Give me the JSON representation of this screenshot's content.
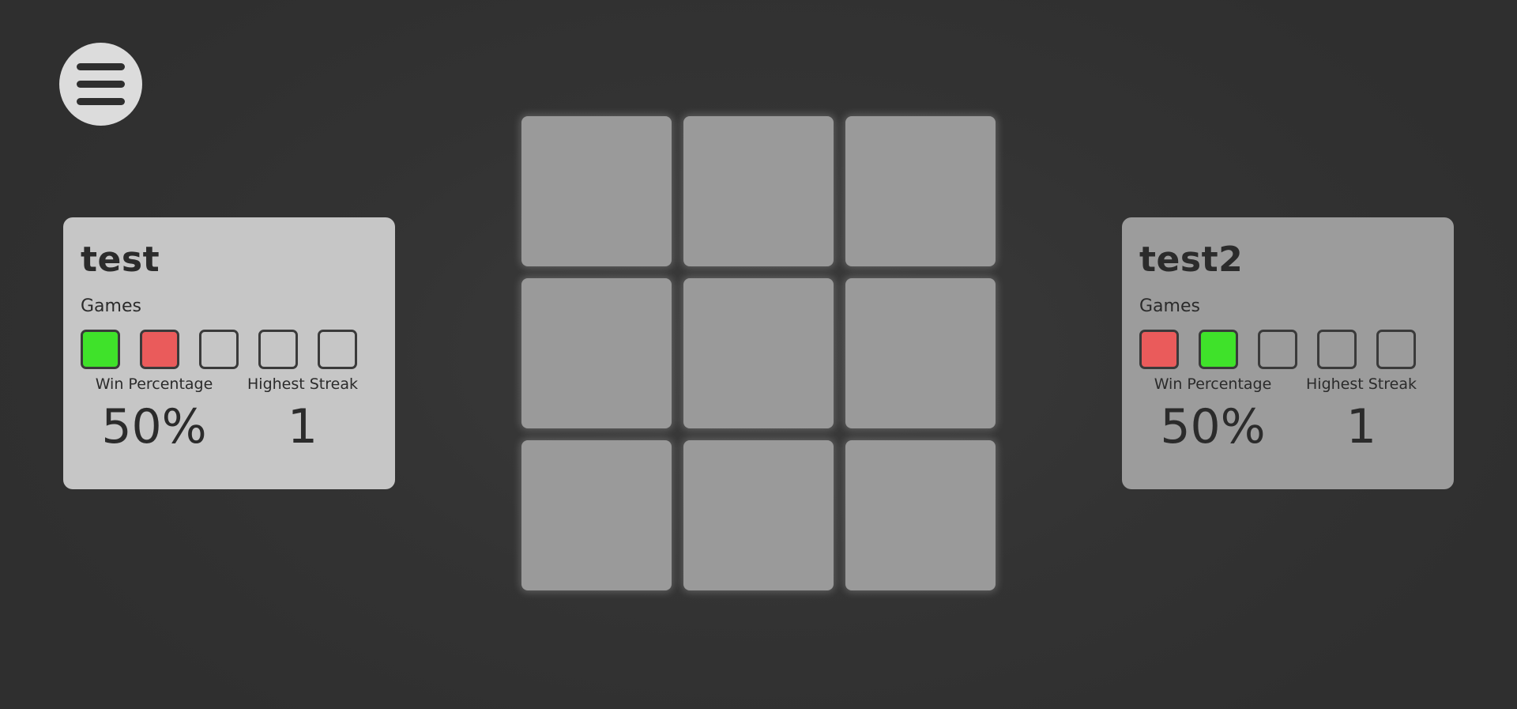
{
  "menu": {
    "icon": "hamburger-menu-icon"
  },
  "players": [
    {
      "name": "test",
      "games_label": "Games",
      "games": [
        "win",
        "loss",
        "empty",
        "empty",
        "empty"
      ],
      "win_percentage_label": "Win Percentage",
      "win_percentage": "50%",
      "highest_streak_label": "Highest Streak",
      "highest_streak": "1"
    },
    {
      "name": "test2",
      "games_label": "Games",
      "games": [
        "loss",
        "win",
        "empty",
        "empty",
        "empty"
      ],
      "win_percentage_label": "Win Percentage",
      "win_percentage": "50%",
      "highest_streak_label": "Highest Streak",
      "highest_streak": "1"
    }
  ],
  "board": {
    "cells": [
      "",
      "",
      "",
      "",
      "",
      "",
      "",
      "",
      ""
    ]
  },
  "colors": {
    "background": "#333333",
    "card_active": "#c6c6c6",
    "card_inactive": "#9c9c9c",
    "cell": "#9a9a9a",
    "win": "#3fe22a",
    "loss": "#ea5b5b"
  }
}
